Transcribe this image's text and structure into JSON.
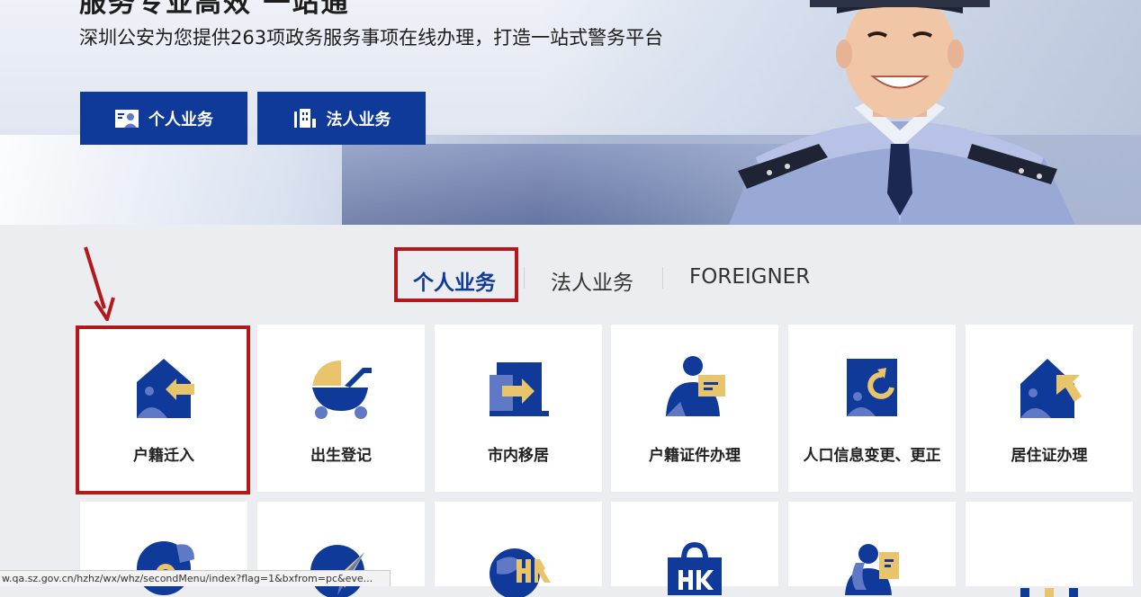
{
  "hero": {
    "title": "服务专业高效 一站通",
    "subtitle": "深圳公安为您提供263项政务服务事项在线办理，打造一站式警务平台",
    "buttons": [
      {
        "label": "个人业务",
        "icon": "person-card-icon"
      },
      {
        "label": "法人业务",
        "icon": "building-icon"
      }
    ]
  },
  "tabs": [
    {
      "label": "个人业务",
      "active": true
    },
    {
      "label": "法人业务",
      "active": false
    },
    {
      "label": "FOREIGNER",
      "active": false
    }
  ],
  "services_row1": [
    {
      "label": "户籍迁入",
      "icon": "house-arrow-in-icon",
      "highlighted": true
    },
    {
      "label": "出生登记",
      "icon": "baby-stroller-icon"
    },
    {
      "label": "市内移居",
      "icon": "door-arrow-icon"
    },
    {
      "label": "户籍证件办理",
      "icon": "person-card-icon"
    },
    {
      "label": "人口信息变更、更正",
      "icon": "clipboard-refresh-icon"
    },
    {
      "label": "居住证办理",
      "icon": "house-pointer-icon"
    }
  ],
  "services_row2": [
    {
      "icon": "location-pin-icon"
    },
    {
      "icon": "paper-plane-icon"
    },
    {
      "icon": "hk-globe-icon"
    },
    {
      "icon": "hk-bag-icon"
    },
    {
      "icon": "person-document-icon"
    },
    {
      "icon": "more-dots-icon"
    }
  ],
  "status_bar": {
    "url": "w.qa.sz.gov.cn/hzhz/wx/whz/secondMenu/index?flag=1&bxfrom=pc&eve..."
  },
  "colors": {
    "primary": "#0f3a9a",
    "accent": "#e9c46a",
    "highlight": "#b5181a",
    "icon_light": "#5f79c7"
  }
}
